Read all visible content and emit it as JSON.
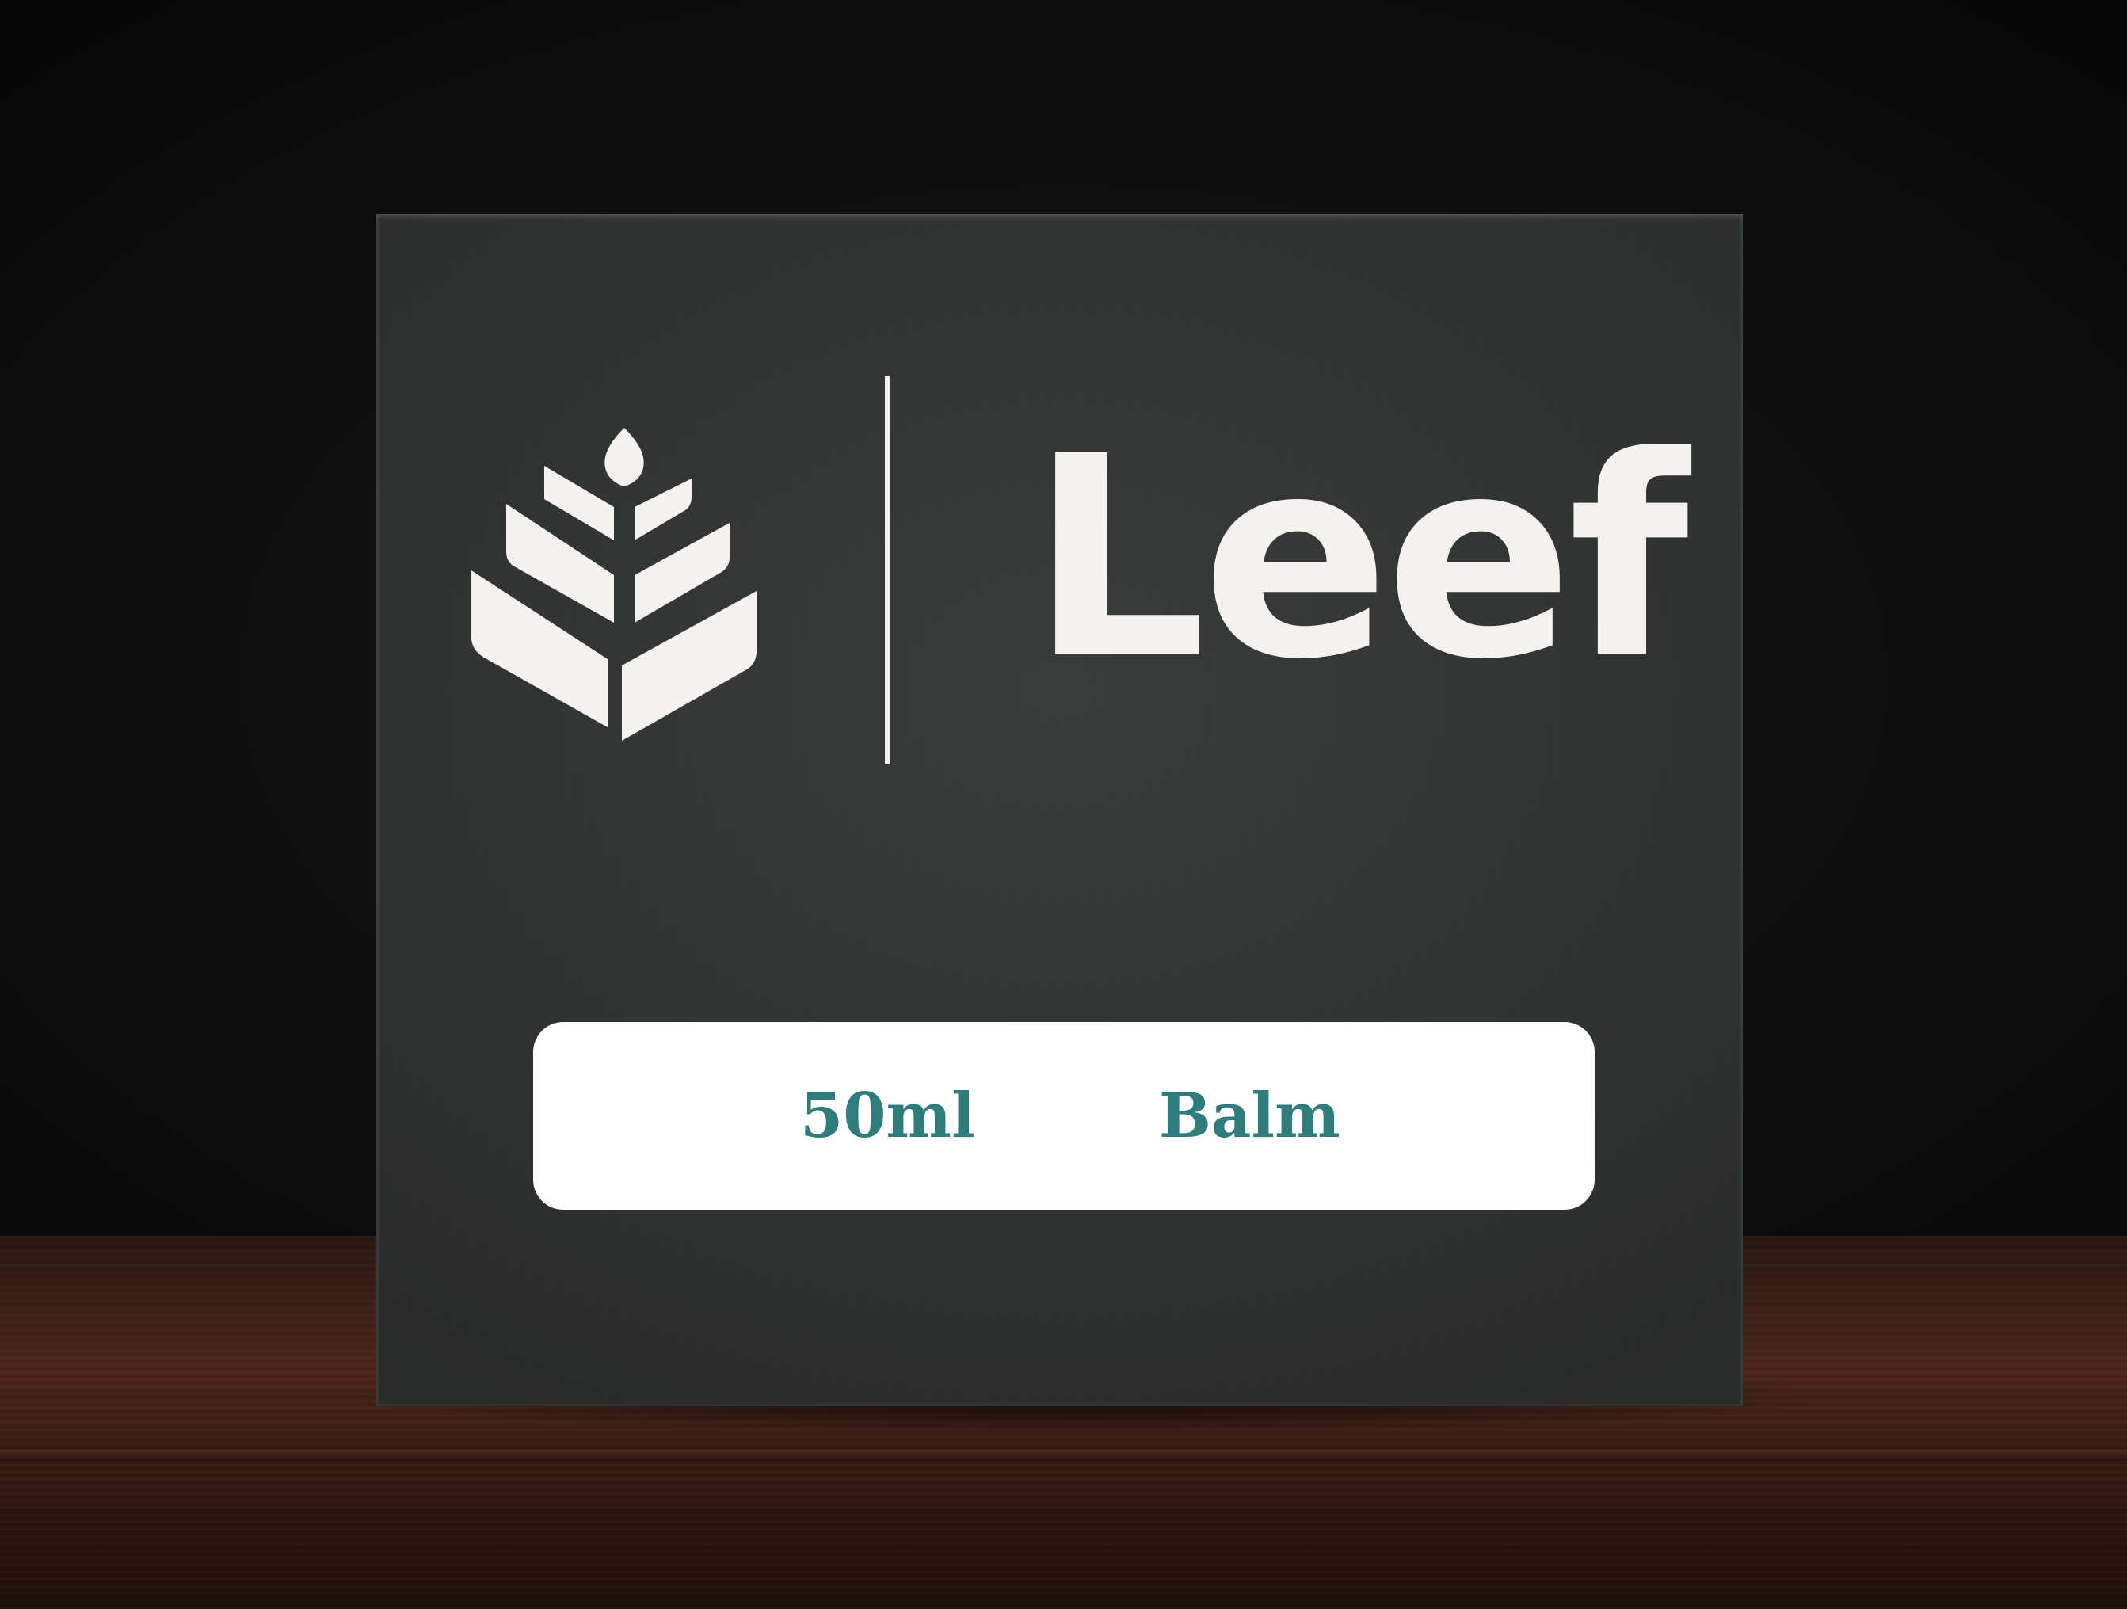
{
  "brand": {
    "name": "Leef",
    "logo_icon": "leaf-sprout-icon",
    "color": "#f3f2ef"
  },
  "label": {
    "volume": "50ml",
    "product_type": "Balm",
    "text_color": "#2f7c7d",
    "background": "#ffffff"
  },
  "box": {
    "color": "#2e302f"
  },
  "surface": {
    "color": "#3a1f15"
  }
}
